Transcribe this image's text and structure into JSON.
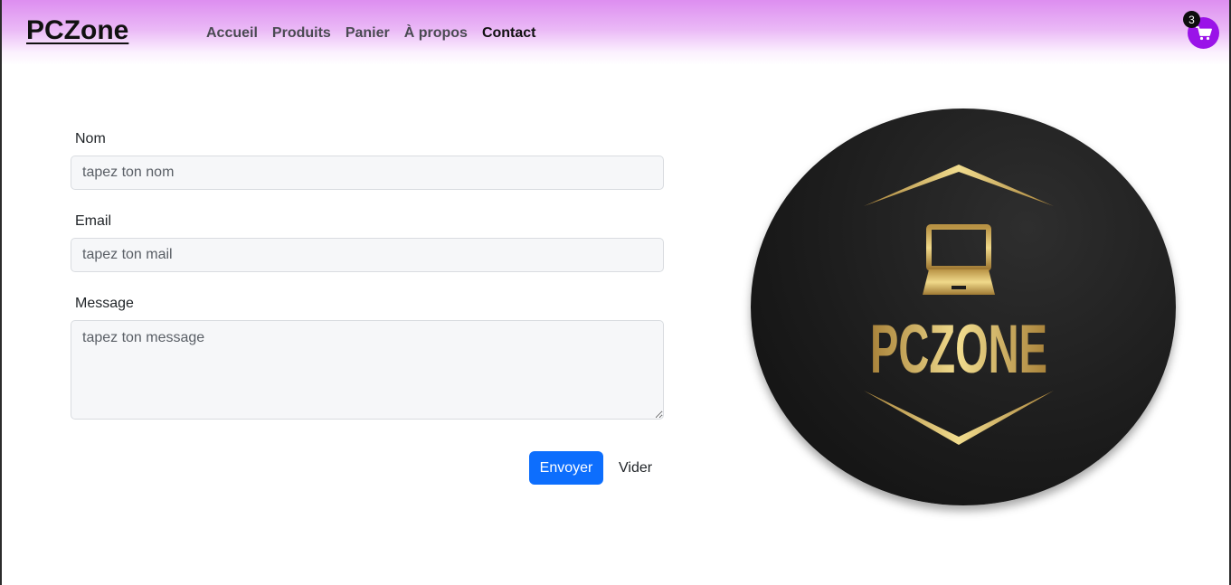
{
  "brand": "PCZone",
  "nav": {
    "items": [
      {
        "label": "Accueil"
      },
      {
        "label": "Produits"
      },
      {
        "label": "Panier"
      },
      {
        "label": "À propos"
      },
      {
        "label": "Contact",
        "active": true
      }
    ]
  },
  "cart": {
    "count": "3",
    "icon": "cart-icon",
    "color": "#9a13e8"
  },
  "form": {
    "name_label": "Nom",
    "name_placeholder": "tapez ton nom",
    "email_label": "Email",
    "email_placeholder": "tapez ton mail",
    "message_label": "Message",
    "message_placeholder": "tapez ton message",
    "submit_label": "Envoyer",
    "reset_label": "Vider"
  },
  "logo": {
    "text": "PCZONE",
    "icon": "laptop-icon"
  },
  "colors": {
    "accent": "#0d6efd",
    "navbar": "#dd8ef0",
    "gold": "#d4b560"
  }
}
